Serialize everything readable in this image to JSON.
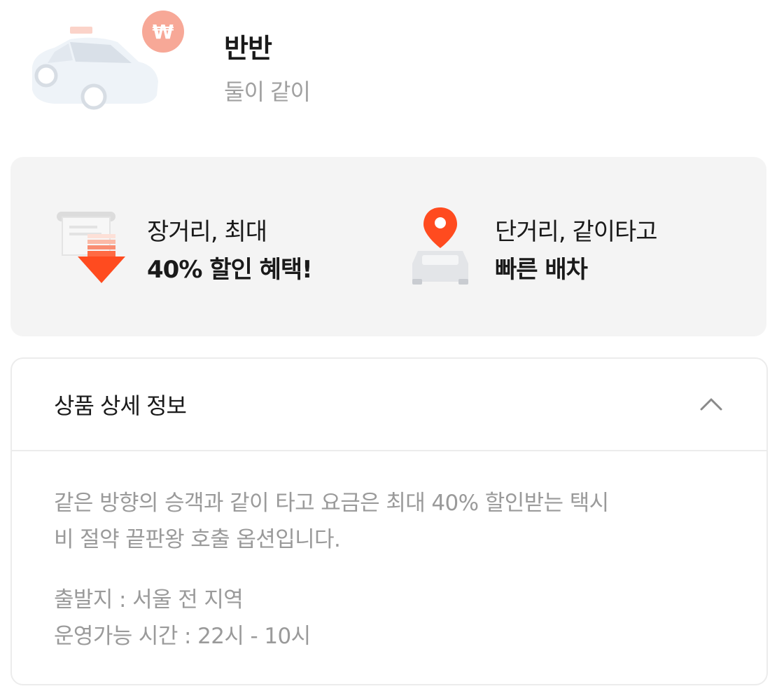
{
  "product": {
    "title": "반반",
    "subtitle": "둘이 같이",
    "badge_symbol": "₩",
    "accent_color": "#ff4b1f",
    "badge_color": "#f7a897"
  },
  "benefits": [
    {
      "icon": "discount-receipt-icon",
      "line1": "장거리, 최대",
      "line2": "40% 할인 혜택!"
    },
    {
      "icon": "pin-car-icon",
      "line1": "단거리, 같이타고",
      "line2": "빠른 배차"
    }
  ],
  "details": {
    "title": "상품 상세 정보",
    "toggle_icon": "chevron-up-icon",
    "description_line1": "같은 방향의 승객과 같이 타고 요금은 최대 40% 할인받는 택시",
    "description_line2": "비 절약 끝판왕 호출 옵션입니다.",
    "departure": "출발지 : 서울 전 지역",
    "hours": "운영가능 시간 : 22시 - 10시"
  }
}
